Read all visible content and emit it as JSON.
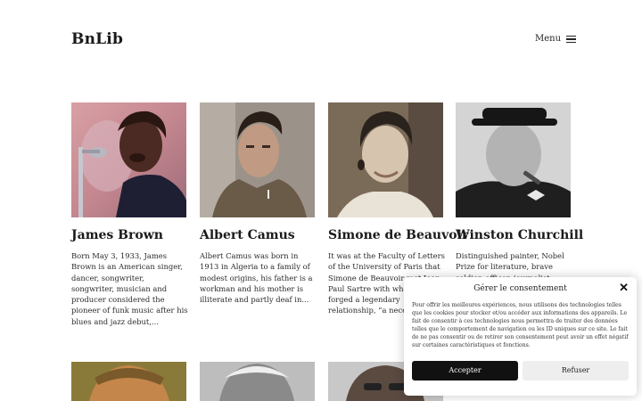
{
  "site": {
    "brand": "BnLib",
    "menu_label": "Menu"
  },
  "cards": [
    {
      "name": " James Brown",
      "excerpt": "Born May 3, 1933, James Brown is an American singer, dancer, songwriter, songwriter, musician and producer considered the pioneer of funk music after his blues and jazz debut,..."
    },
    {
      "name": "Albert Camus",
      "excerpt": "Albert Camus was born in 1913 in Algeria to a family of modest origins, his father is a workman and his mother is illiterate and partly deaf in..."
    },
    {
      "name": "Simone de Beauvoir",
      "excerpt": "It was at the Faculty of Letters of the University of Paris that Simone de Beauvoir met Jean-Paul Sartre with whom she forged a legendary relationship, “a necessary..."
    },
    {
      "name": "Winston Churchill",
      "excerpt": "Distinguished painter, Nobel Prize for literature, brave soldier, officer, journalist, committed..."
    }
  ],
  "consent": {
    "title": "Gérer le consentement",
    "text": "Pour offrir les meilleures expériences, nous utilisons des technologies telles que les cookies pour stocker et/ou accéder aux informations des appareils. Le fait de consentir à ces technologies nous permettra de traiter des données telles que le comportement de navigation ou les ID uniques sur ce site. Le fait de ne pas consentir ou de retirer son consentement peut avoir un effet négatif sur certaines caractéristiques et fonctions.",
    "accept_label": "Accepter",
    "refuse_label": "Refuser",
    "close_icon": "close-icon"
  }
}
